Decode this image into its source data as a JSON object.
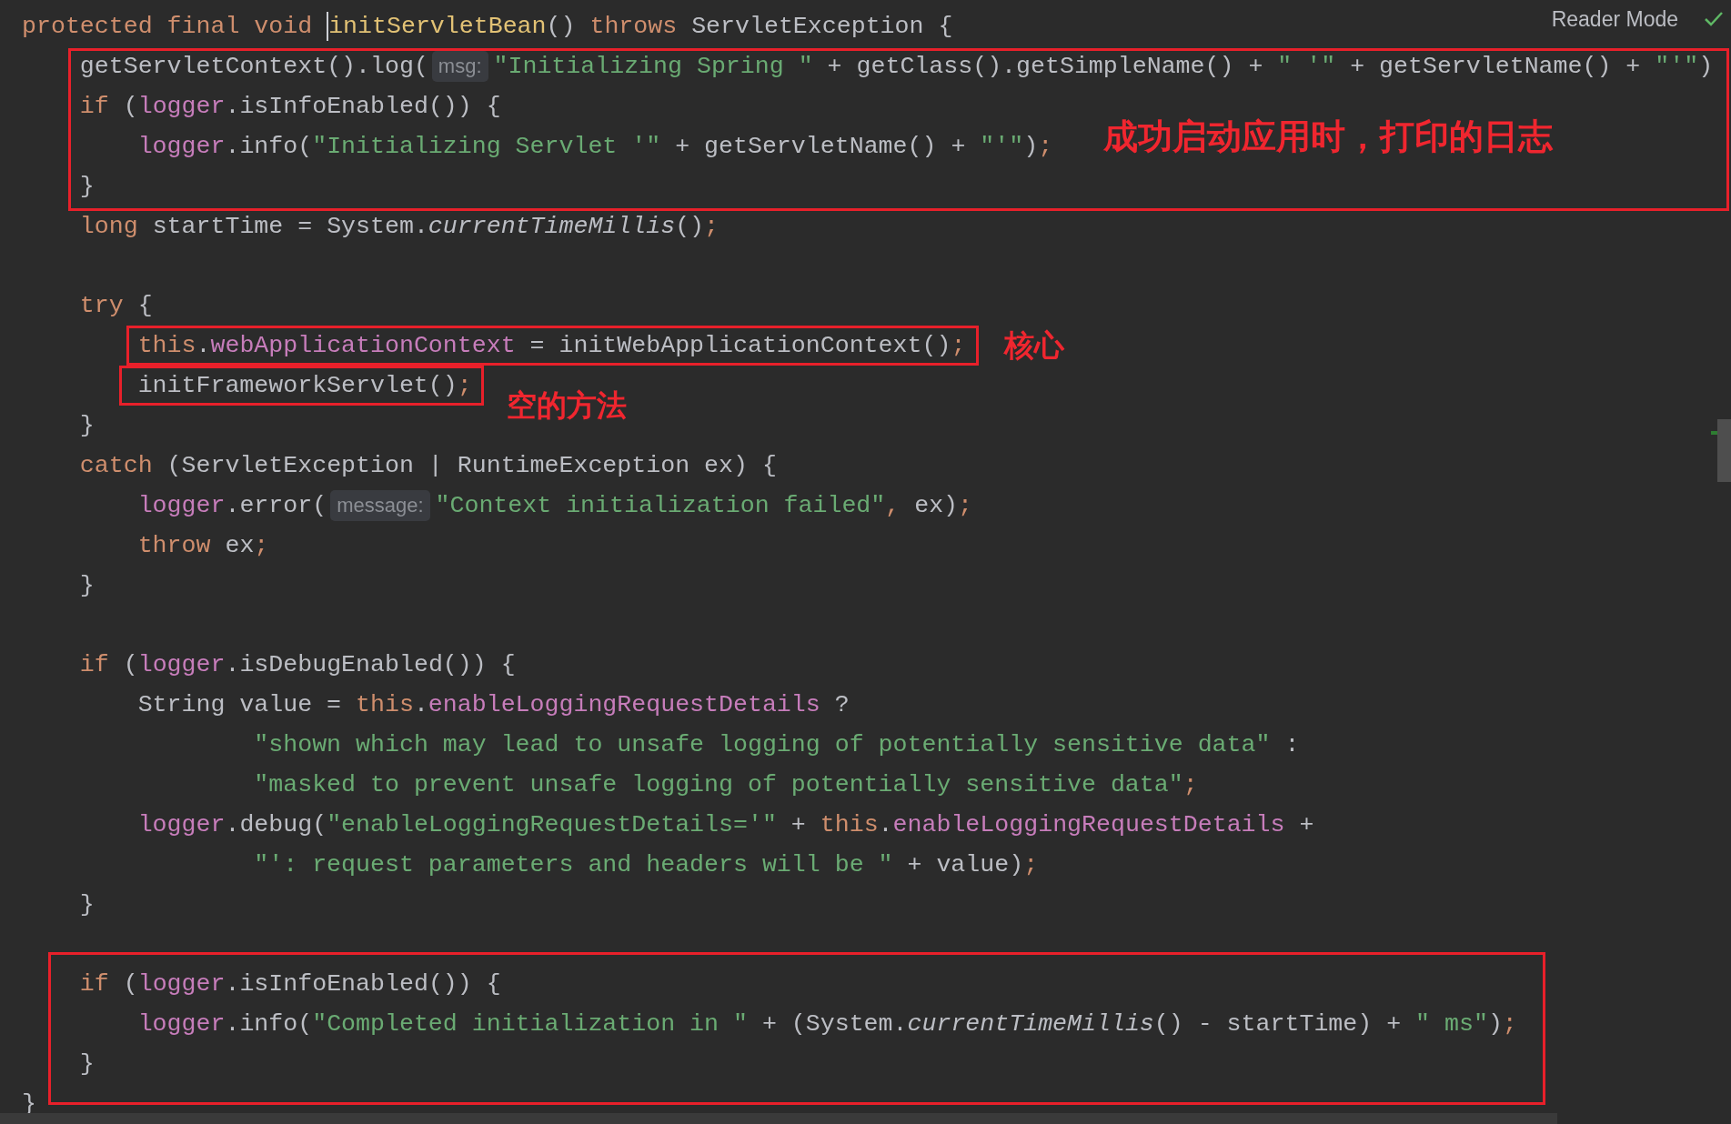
{
  "reader_mode": {
    "label": "Reader Mode"
  },
  "lines": [
    {
      "kind": "code",
      "tokens": [
        {
          "kind": "keyword",
          "text": "protected final void "
        },
        {
          "kind": "decl",
          "text": "initServletBean"
        },
        {
          "kind": "plain",
          "text": "() "
        },
        {
          "kind": "keyword",
          "text": "throws "
        },
        {
          "kind": "plain",
          "text": "ServletException {"
        }
      ]
    },
    {
      "kind": "code",
      "tokens": [
        {
          "kind": "plain",
          "text": "    getServletContext().log("
        },
        {
          "kind": "hint",
          "text": "msg:"
        },
        {
          "kind": "string",
          "text": "\"Initializing Spring \""
        },
        {
          "kind": "plain",
          "text": " + getClass().getSimpleName() + "
        },
        {
          "kind": "string",
          "text": "\" '\""
        },
        {
          "kind": "plain",
          "text": " + getServletName() + "
        },
        {
          "kind": "string",
          "text": "\"'\""
        },
        {
          "kind": "plain",
          "text": ")"
        }
      ]
    },
    {
      "kind": "code",
      "tokens": [
        {
          "kind": "keyword",
          "text": "    if "
        },
        {
          "kind": "plain",
          "text": "("
        },
        {
          "kind": "field",
          "text": "logger"
        },
        {
          "kind": "plain",
          "text": ".isInfoEnabled()) {"
        }
      ]
    },
    {
      "kind": "code",
      "tokens": [
        {
          "kind": "field",
          "text": "        logger"
        },
        {
          "kind": "plain",
          "text": ".info("
        },
        {
          "kind": "string",
          "text": "\"Initializing Servlet '\""
        },
        {
          "kind": "plain",
          "text": " + getServletName() + "
        },
        {
          "kind": "string",
          "text": "\"'\""
        },
        {
          "kind": "plain",
          "text": ")"
        },
        {
          "kind": "keyword",
          "text": ";"
        }
      ]
    },
    {
      "kind": "code",
      "tokens": [
        {
          "kind": "plain",
          "text": "    }"
        }
      ]
    },
    {
      "kind": "code",
      "tokens": [
        {
          "kind": "keyword",
          "text": "    long "
        },
        {
          "kind": "plain",
          "text": "startTime = System."
        },
        {
          "kind": "static",
          "text": "currentTimeMillis"
        },
        {
          "kind": "plain",
          "text": "()"
        },
        {
          "kind": "keyword",
          "text": ";"
        }
      ]
    },
    {
      "kind": "blank"
    },
    {
      "kind": "code",
      "tokens": [
        {
          "kind": "keyword",
          "text": "    try "
        },
        {
          "kind": "plain",
          "text": "{"
        }
      ]
    },
    {
      "kind": "code",
      "tokens": [
        {
          "kind": "keyword",
          "text": "        this"
        },
        {
          "kind": "plain",
          "text": "."
        },
        {
          "kind": "field",
          "text": "webApplicationContext"
        },
        {
          "kind": "plain",
          "text": " = initWebApplicationContext()"
        },
        {
          "kind": "keyword",
          "text": ";"
        }
      ]
    },
    {
      "kind": "code",
      "tokens": [
        {
          "kind": "plain",
          "text": "        initFrameworkServlet()"
        },
        {
          "kind": "keyword",
          "text": ";"
        }
      ]
    },
    {
      "kind": "code",
      "tokens": [
        {
          "kind": "plain",
          "text": "    }"
        }
      ]
    },
    {
      "kind": "code",
      "tokens": [
        {
          "kind": "keyword",
          "text": "    catch "
        },
        {
          "kind": "plain",
          "text": "(ServletException | RuntimeException ex) {"
        }
      ]
    },
    {
      "kind": "code",
      "tokens": [
        {
          "kind": "field",
          "text": "        logger"
        },
        {
          "kind": "plain",
          "text": ".error("
        },
        {
          "kind": "hint",
          "text": "message:"
        },
        {
          "kind": "string",
          "text": "\"Context initialization failed\""
        },
        {
          "kind": "keyword",
          "text": ", "
        },
        {
          "kind": "plain",
          "text": "ex)"
        },
        {
          "kind": "keyword",
          "text": ";"
        }
      ]
    },
    {
      "kind": "code",
      "tokens": [
        {
          "kind": "keyword",
          "text": "        throw "
        },
        {
          "kind": "plain",
          "text": "ex"
        },
        {
          "kind": "keyword",
          "text": ";"
        }
      ]
    },
    {
      "kind": "code",
      "tokens": [
        {
          "kind": "plain",
          "text": "    }"
        }
      ]
    },
    {
      "kind": "blank"
    },
    {
      "kind": "code",
      "tokens": [
        {
          "kind": "keyword",
          "text": "    if "
        },
        {
          "kind": "plain",
          "text": "("
        },
        {
          "kind": "field",
          "text": "logger"
        },
        {
          "kind": "plain",
          "text": ".isDebugEnabled()) {"
        }
      ]
    },
    {
      "kind": "code",
      "tokens": [
        {
          "kind": "plain",
          "text": "        String value = "
        },
        {
          "kind": "keyword",
          "text": "this"
        },
        {
          "kind": "plain",
          "text": "."
        },
        {
          "kind": "field",
          "text": "enableLoggingRequestDetails"
        },
        {
          "kind": "plain",
          "text": " ?"
        }
      ]
    },
    {
      "kind": "code",
      "tokens": [
        {
          "kind": "string",
          "text": "                \"shown which may lead to unsafe logging of potentially sensitive data\""
        },
        {
          "kind": "plain",
          "text": " :"
        }
      ]
    },
    {
      "kind": "code",
      "tokens": [
        {
          "kind": "string",
          "text": "                \"masked to prevent unsafe logging of potentially sensitive data\""
        },
        {
          "kind": "keyword",
          "text": ";"
        }
      ]
    },
    {
      "kind": "code",
      "tokens": [
        {
          "kind": "field",
          "text": "        logger"
        },
        {
          "kind": "plain",
          "text": ".debug("
        },
        {
          "kind": "string",
          "text": "\"enableLoggingRequestDetails='\""
        },
        {
          "kind": "plain",
          "text": " + "
        },
        {
          "kind": "keyword",
          "text": "this"
        },
        {
          "kind": "plain",
          "text": "."
        },
        {
          "kind": "field",
          "text": "enableLoggingRequestDetails"
        },
        {
          "kind": "plain",
          "text": " +"
        }
      ]
    },
    {
      "kind": "code",
      "tokens": [
        {
          "kind": "string",
          "text": "                \"': request parameters and headers will be \""
        },
        {
          "kind": "plain",
          "text": " + value)"
        },
        {
          "kind": "keyword",
          "text": ";"
        }
      ]
    },
    {
      "kind": "code",
      "tokens": [
        {
          "kind": "plain",
          "text": "    }"
        }
      ]
    },
    {
      "kind": "blank"
    },
    {
      "kind": "code",
      "tokens": [
        {
          "kind": "keyword",
          "text": "    if "
        },
        {
          "kind": "plain",
          "text": "("
        },
        {
          "kind": "field",
          "text": "logger"
        },
        {
          "kind": "plain",
          "text": ".isInfoEnabled()) {"
        }
      ]
    },
    {
      "kind": "code",
      "tokens": [
        {
          "kind": "field",
          "text": "        logger"
        },
        {
          "kind": "plain",
          "text": ".info("
        },
        {
          "kind": "string",
          "text": "\"Completed initialization in \""
        },
        {
          "kind": "plain",
          "text": " + (System."
        },
        {
          "kind": "static",
          "text": "currentTimeMillis"
        },
        {
          "kind": "plain",
          "text": "() - startTime) + "
        },
        {
          "kind": "string",
          "text": "\" ms\""
        },
        {
          "kind": "plain",
          "text": ")"
        },
        {
          "kind": "keyword",
          "text": ";"
        }
      ]
    },
    {
      "kind": "code",
      "tokens": [
        {
          "kind": "plain",
          "text": "    }"
        }
      ]
    },
    {
      "kind": "code",
      "tokens": [
        {
          "kind": "plain",
          "text": "}"
        }
      ]
    }
  ],
  "annotations": [
    {
      "kind": "labelled",
      "label": "成功启动应用时，打印的日志"
    },
    {
      "kind": "labelled",
      "label": "核心"
    },
    {
      "kind": "labelled",
      "label": "空的方法"
    },
    {
      "kind": "plain"
    }
  ]
}
